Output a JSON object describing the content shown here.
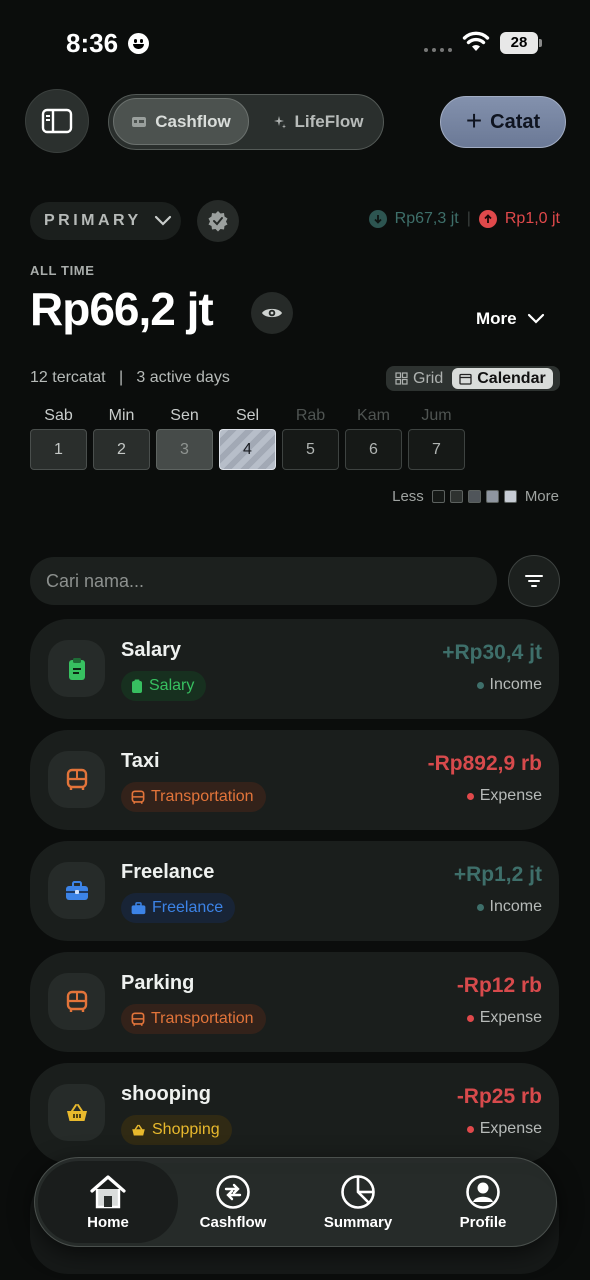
{
  "status": {
    "time": "8:36",
    "battery": "28"
  },
  "header": {
    "sidebar_icon": "sidebar-icon",
    "tabs": [
      {
        "label": "Cashflow",
        "icon": "wallet-icon",
        "active": true
      },
      {
        "label": "LifeFlow",
        "icon": "sparkle-icon",
        "active": false
      }
    ],
    "catat_plus": "+",
    "catat_label": "Catat"
  },
  "account": {
    "name": "PRIMARY",
    "income_total": "Rp67,3 jt",
    "expense_total": "Rp1,0 jt",
    "separator": "|"
  },
  "balance": {
    "label": "ALL TIME",
    "amount": "Rp66,2 jt",
    "more_label": "More"
  },
  "summary": {
    "stats": "12 tercatat   |   3 active days",
    "view_grid": "Grid",
    "view_calendar": "Calendar"
  },
  "calendar": {
    "days": [
      {
        "name": "Sab",
        "date": "1"
      },
      {
        "name": "Min",
        "date": "2"
      },
      {
        "name": "Sen",
        "date": "3"
      },
      {
        "name": "Sel",
        "date": "4"
      },
      {
        "name": "Rab",
        "date": "5"
      },
      {
        "name": "Kam",
        "date": "6"
      },
      {
        "name": "Jum",
        "date": "7"
      }
    ],
    "legend_less": "Less",
    "legend_more": "More"
  },
  "search": {
    "placeholder": "Cari nama..."
  },
  "transactions": [
    {
      "name": "Salary",
      "category": "Salary",
      "amount": "+Rp30,4 jt",
      "type": "Income",
      "icon": "clipboard-icon",
      "color": "#37c060"
    },
    {
      "name": "Taxi",
      "category": "Transportation",
      "amount": "-Rp892,9 rb",
      "type": "Expense",
      "icon": "bus-icon",
      "color": "#e2743a"
    },
    {
      "name": "Freelance",
      "category": "Freelance",
      "amount": "+Rp1,2 jt",
      "type": "Income",
      "icon": "briefcase-icon",
      "color": "#3c83e6"
    },
    {
      "name": "Parking",
      "category": "Transportation",
      "amount": "-Rp12 rb",
      "type": "Expense",
      "icon": "bus-icon",
      "color": "#e2743a"
    },
    {
      "name": "shooping",
      "category": "Shopping",
      "amount": "-Rp25 rb",
      "type": "Expense",
      "icon": "basket-icon",
      "color": "#e8b92d"
    }
  ],
  "nav": {
    "items": [
      {
        "label": "Home",
        "icon": "home-icon",
        "active": true
      },
      {
        "label": "Cashflow",
        "icon": "cashflow-icon"
      },
      {
        "label": "Summary",
        "icon": "pie-chart-icon"
      },
      {
        "label": "Profile",
        "icon": "user-icon"
      }
    ]
  }
}
